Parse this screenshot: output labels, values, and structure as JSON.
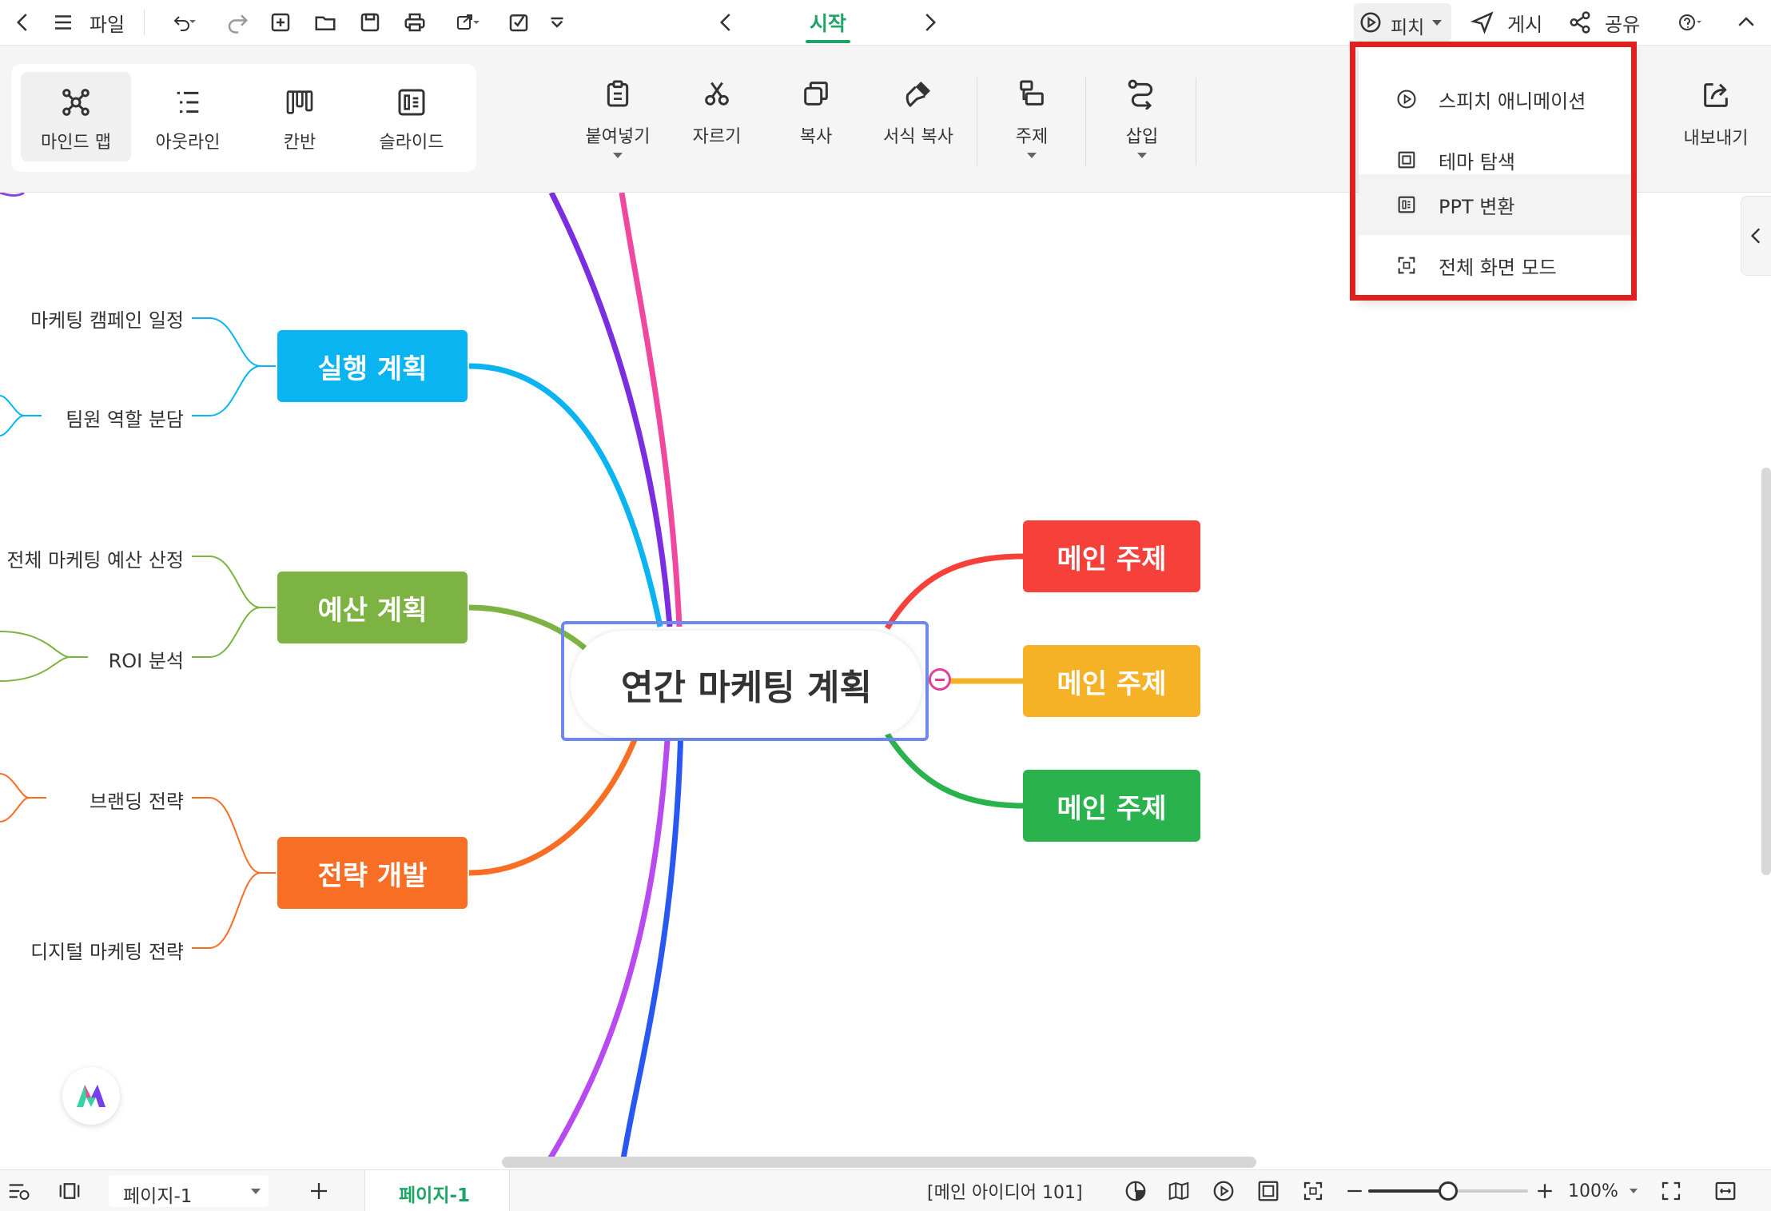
{
  "topbar": {
    "file_label": "파일",
    "active_tab": "시작",
    "pitch_label": "피치",
    "publish_label": "게시",
    "share_label": "공유"
  },
  "ribbon": {
    "views": [
      {
        "label": "마인드 맵",
        "icon": "mindmap-icon",
        "selected": true
      },
      {
        "label": "아웃라인",
        "icon": "outline-icon"
      },
      {
        "label": "칸반",
        "icon": "kanban-icon"
      },
      {
        "label": "슬라이드",
        "icon": "slide-icon"
      }
    ],
    "tools": {
      "paste": "붙여넣기",
      "cut": "자르기",
      "copy": "복사",
      "format_painter": "서식 복사",
      "topic": "주제",
      "insert": "삽입"
    },
    "export_label": "내보내기"
  },
  "pitch_menu": {
    "items": [
      {
        "label": "스피치 애니메이션",
        "icon": "play-circle-icon"
      },
      {
        "label": "테마 탐색",
        "icon": "theme-frame-icon"
      },
      {
        "label": "PPT 변환",
        "icon": "ppt-icon",
        "highlighted": true
      },
      {
        "label": "전체 화면 모드",
        "icon": "fullscreen-icon"
      }
    ],
    "highlight_color": "#e02020"
  },
  "mindmap": {
    "central": "연간 마케팅 계획",
    "left_topics": [
      {
        "label": "실행 계획",
        "color": "#0ab4f0",
        "subtopics": [
          "마케팅 캠페인 일정",
          "팀원 역할 분담"
        ]
      },
      {
        "label": "예산 계획",
        "color": "#7cb342",
        "subtopics": [
          "전체 마케팅 예산 산정",
          "ROI 분석"
        ]
      },
      {
        "label": "전략 개발",
        "color": "#f96e25",
        "subtopics": [
          "브랜딩 전략",
          "디지털 마케팅 전략"
        ]
      }
    ],
    "right_topics": [
      {
        "label": "메인 주제",
        "color": "#f5413a"
      },
      {
        "label": "메인 주제",
        "color": "#f6b227"
      },
      {
        "label": "메인 주제",
        "color": "#2ab24d"
      }
    ]
  },
  "statusbar": {
    "page_select": "페이지-1",
    "active_page_tab": "페이지-1",
    "element_count": "[메인 아이디어 101]",
    "zoom": "100%",
    "zoom_level": 0.5
  }
}
